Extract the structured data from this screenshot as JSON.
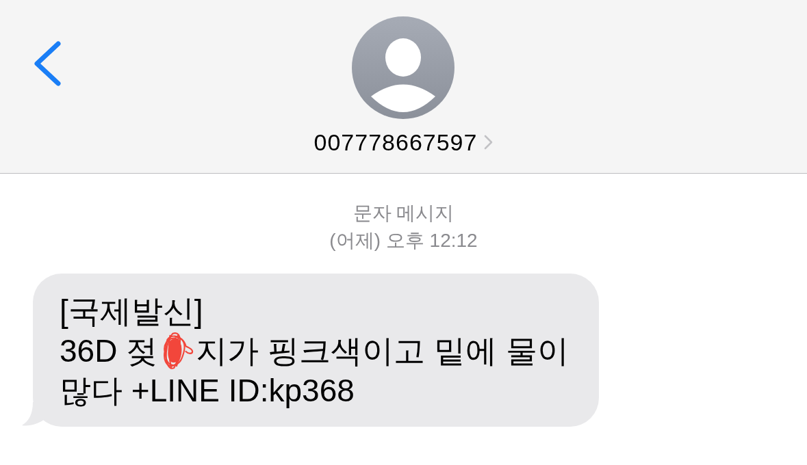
{
  "header": {
    "contact": "007778667597"
  },
  "conversation": {
    "service": "문자 메시지",
    "timestamp": "(어제) 오후 12:12",
    "messages": [
      {
        "kind": "received",
        "lines": [
          {
            "segments": [
              {
                "kind": "text",
                "text": "[국제발신]"
              }
            ]
          },
          {
            "segments": [
              {
                "kind": "text",
                "text": "36D 젖"
              },
              {
                "kind": "redaction"
              },
              {
                "kind": "text",
                "text": "지가 핑크색이고 밑에 물이"
              }
            ]
          },
          {
            "segments": [
              {
                "kind": "text",
                "text": "많다 +LINE ID:kp368"
              }
            ]
          }
        ]
      }
    ]
  }
}
